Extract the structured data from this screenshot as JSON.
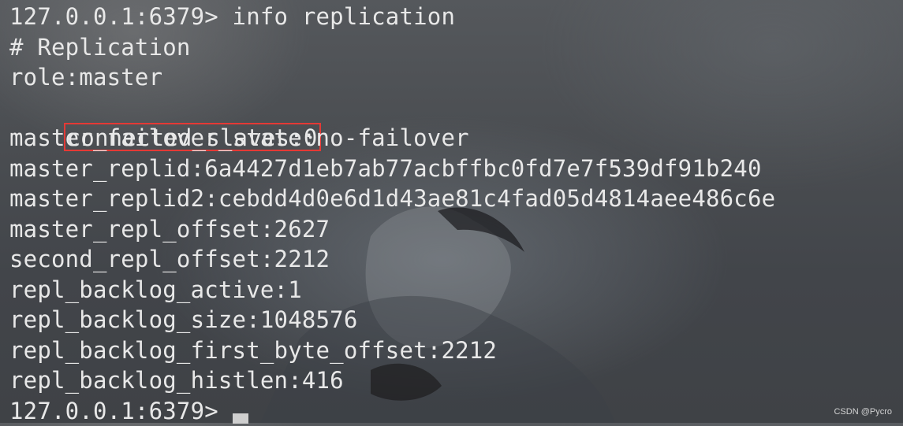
{
  "terminal": {
    "lines": [
      "127.0.0.1:6379> info replication",
      "# Replication",
      "role:master",
      "connected_slaves:0",
      "master_failover_state:no-failover",
      "master_replid:6a4427d1eb7ab77acbffbc0fd7e7f539df91b240",
      "master_replid2:cebdd4d0e6d1d43ae81c4fad05d4814aee486c6e",
      "master_repl_offset:2627",
      "second_repl_offset:2212",
      "repl_backlog_active:1",
      "repl_backlog_size:1048576",
      "repl_backlog_first_byte_offset:2212",
      "repl_backlog_histlen:416",
      "127.0.0.1:6379>"
    ],
    "highlight_color": "#e53935",
    "text_color": "#e8e8e8"
  },
  "watermark": "CSDN @Pycro"
}
